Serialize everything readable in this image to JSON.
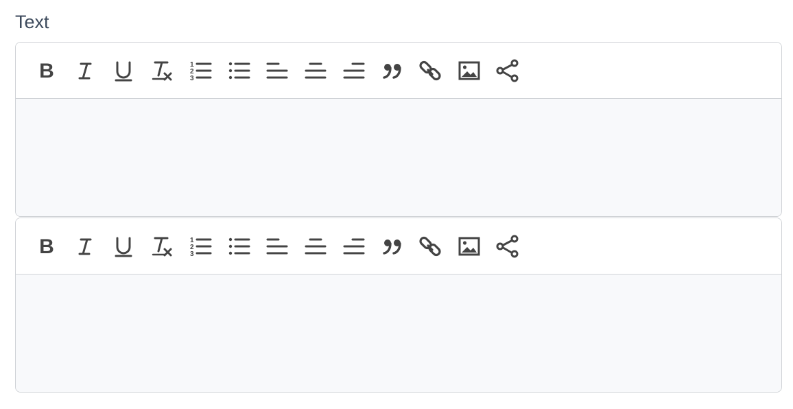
{
  "field": {
    "label": "Text"
  },
  "editors": [
    {
      "id": "editor-1",
      "content": "",
      "toolbar": [
        "bold-icon",
        "italic-icon",
        "underline-icon",
        "clear-format-icon",
        "ordered-list-icon",
        "bullet-list-icon",
        "align-left-icon",
        "align-center-icon",
        "align-right-icon",
        "blockquote-icon",
        "link-icon",
        "image-icon",
        "share-icon"
      ]
    },
    {
      "id": "editor-2",
      "content": "",
      "toolbar": [
        "bold-icon",
        "italic-icon",
        "underline-icon",
        "clear-format-icon",
        "ordered-list-icon",
        "bullet-list-icon",
        "align-left-icon",
        "align-center-icon",
        "align-right-icon",
        "blockquote-icon",
        "link-icon",
        "image-icon",
        "share-icon"
      ]
    }
  ],
  "colors": {
    "label": "#3d4a5c",
    "icon": "#444444",
    "border": "#cfd2d6",
    "content_background": "#f8f9fb"
  }
}
